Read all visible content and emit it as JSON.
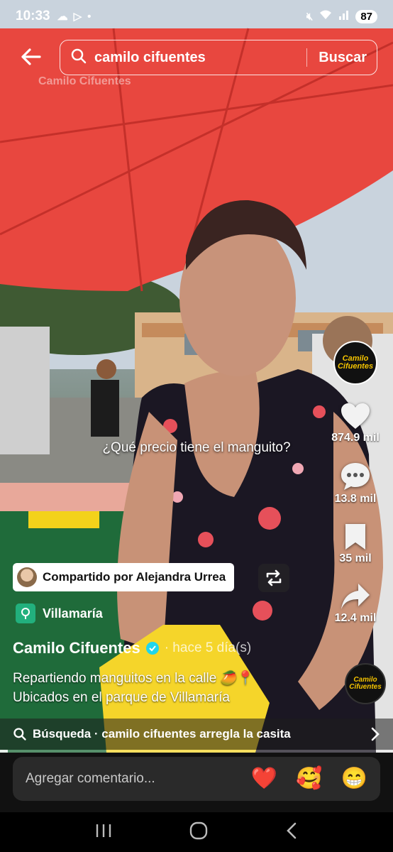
{
  "status_bar": {
    "time": "10:33",
    "battery": "87"
  },
  "search": {
    "query": "camilo cifuentes",
    "button": "Buscar"
  },
  "watermark": "Camilo Cifuentes",
  "subtitle": "¿Qué precio tiene el manguito?",
  "rail": {
    "creator_logo_line1": "Camilo",
    "creator_logo_line2": "Cifuentes",
    "likes": "874.9 mil",
    "comments": "13.8 mil",
    "saves": "35 mil",
    "shares": "12.4 mil"
  },
  "shared": {
    "label": "Compartido por Alejandra Urrea"
  },
  "location": {
    "name": "Villamaría"
  },
  "author": {
    "name": "Camilo Cifuentes",
    "date": "· hace 5 día(s)"
  },
  "caption": {
    "line1": "Repartiendo manguitos en la calle 🥭📍",
    "line2": "Ubicados en el parque de Villamaría"
  },
  "related": {
    "text": "Búsqueda · camilo cifuentes arregla la casita"
  },
  "progress": {
    "fraction": 0.02
  },
  "comment": {
    "placeholder": "Agregar comentario...",
    "emoji1": "❤️",
    "emoji2": "🥰",
    "emoji3": "😁"
  },
  "colors": {
    "accent_green": "#22b07d",
    "umbrella_red": "#e8473f",
    "verified_blue": "#20d5ec"
  }
}
